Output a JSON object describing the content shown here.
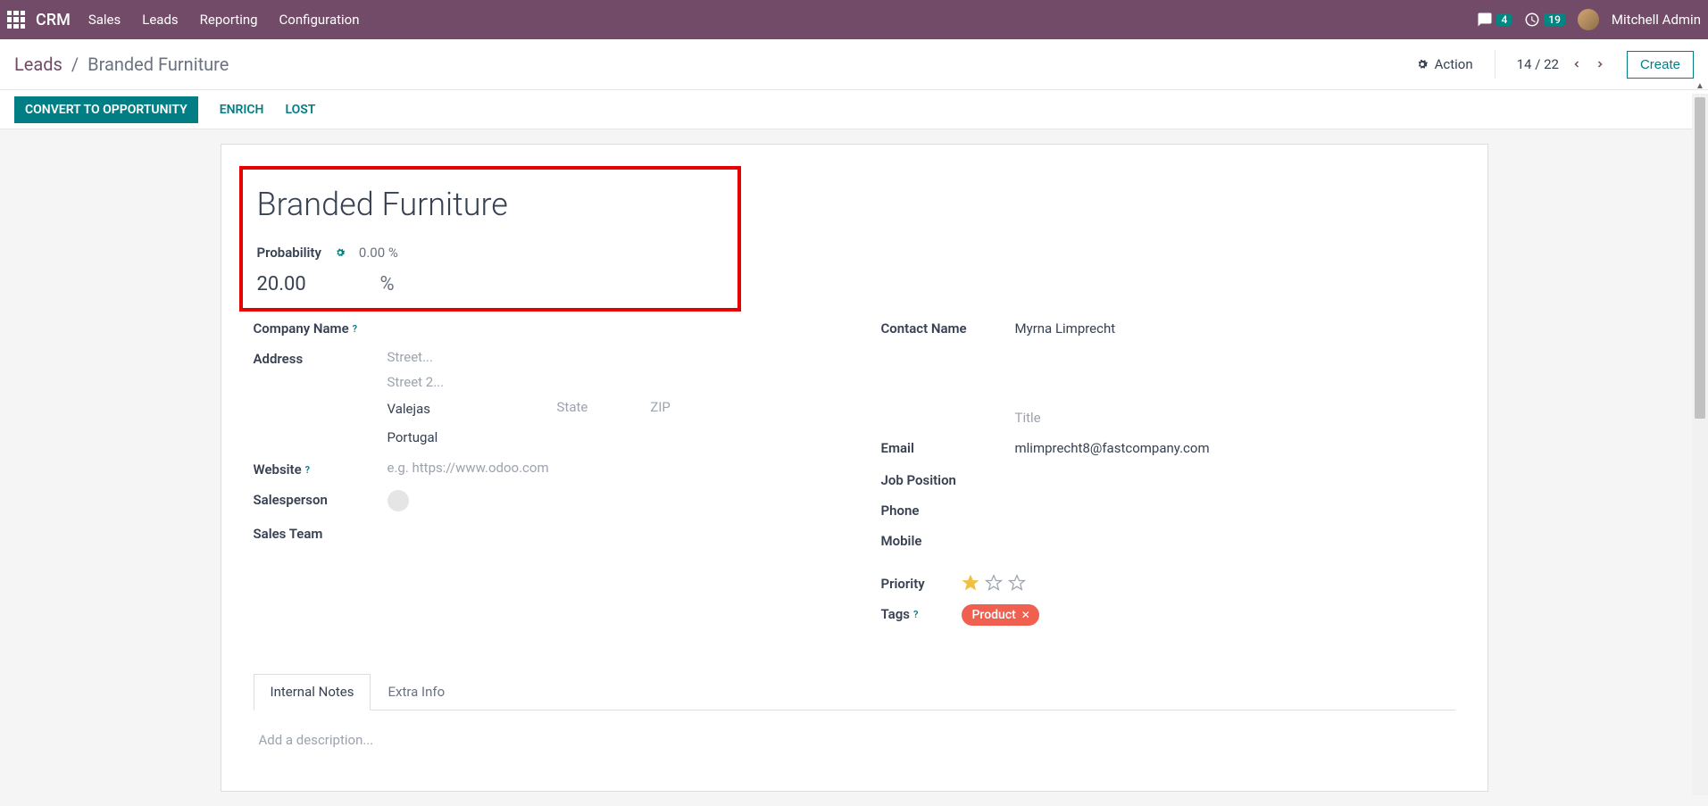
{
  "topbar": {
    "brand": "CRM",
    "nav": [
      "Sales",
      "Leads",
      "Reporting",
      "Configuration"
    ],
    "messages_badge": "4",
    "activities_badge": "19",
    "user_name": "Mitchell Admin"
  },
  "breadcrumb": {
    "parent": "Leads",
    "current": "Branded Furniture"
  },
  "header_actions": {
    "action_label": "Action",
    "pager": "14 / 22",
    "create_label": "Create"
  },
  "actions": {
    "convert": "CONVERT TO OPPORTUNITY",
    "enrich": "ENRICH",
    "lost": "LOST"
  },
  "lead": {
    "title": "Branded Furniture",
    "probability_label": "Probability",
    "probability_hint": "0.00 %",
    "probability_value": "20.00",
    "probability_unit": "%",
    "company_name_label": "Company Name",
    "address_label": "Address",
    "address": {
      "street_ph": "Street...",
      "street2_ph": "Street 2...",
      "city": "Valejas",
      "state_ph": "State",
      "zip_ph": "ZIP",
      "country": "Portugal"
    },
    "website_label": "Website",
    "website_ph": "e.g. https://www.odoo.com",
    "salesperson_label": "Salesperson",
    "sales_team_label": "Sales Team",
    "contact_name_label": "Contact Name",
    "contact_name": "Myrna Limprecht",
    "title_ph": "Title",
    "email_label": "Email",
    "email": "mlimprecht8@fastcompany.com",
    "job_position_label": "Job Position",
    "phone_label": "Phone",
    "mobile_label": "Mobile",
    "priority_label": "Priority",
    "priority_value": 1,
    "tags_label": "Tags",
    "tags": [
      "Product"
    ]
  },
  "tabs": {
    "internal_notes": "Internal Notes",
    "extra_info": "Extra Info",
    "description_ph": "Add a description..."
  }
}
